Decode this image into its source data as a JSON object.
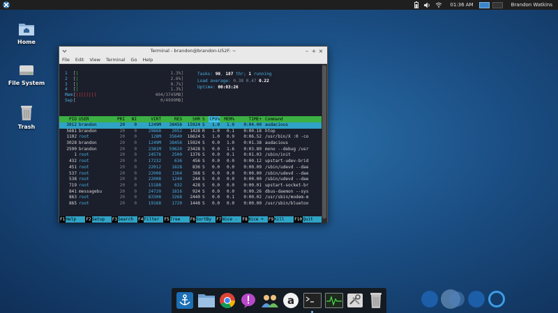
{
  "top_panel": {
    "clock": "01:36 AM",
    "user": "Brandon Watkins"
  },
  "desktop": {
    "icons": [
      {
        "label": "Home"
      },
      {
        "label": "File System"
      },
      {
        "label": "Trash"
      }
    ]
  },
  "terminal": {
    "title": "Terminal - brandon@brandon-U52F: ~",
    "menu": [
      "File",
      "Edit",
      "View",
      "Terminal",
      "Go",
      "Help"
    ],
    "meters": [
      {
        "label": "1",
        "bar": "|",
        "value": "1.3%]"
      },
      {
        "label": "2",
        "bar": "|",
        "value": "2.6%]"
      },
      {
        "label": "3",
        "bar": "|",
        "value": "0.7%]"
      },
      {
        "label": "4",
        "bar": "|",
        "value": "1.3%]"
      },
      {
        "label": "Mem",
        "bar": "||||||||",
        "value": "404/3745MB]"
      },
      {
        "label": "Swp",
        "bar": "",
        "value": "0/4999MB]"
      }
    ],
    "info": {
      "tasks_label": "Tasks:",
      "tasks": "90",
      "threads": "187",
      "thr_label": "thr;",
      "running": "1",
      "running_label": "running",
      "load_label": "Load average:",
      "load1": "0.38",
      "load5": "0.47",
      "load15": "0.22",
      "uptime_label": "Uptime:",
      "uptime": "00:03:26"
    },
    "columns": [
      "PID",
      "USER",
      "PRI",
      "NI",
      "VIRT",
      "RES",
      "SHR",
      "S",
      "CPU%",
      "MEM%",
      "TIME+",
      "Command"
    ],
    "processes": [
      {
        "pid": "3912",
        "user": "brandon",
        "pri": "20",
        "ni": "0",
        "virt": "1249M",
        "res": "38456",
        "shr": "15924",
        "s": "S",
        "cpu": "1.0",
        "mem": "1.0",
        "time": "0:04.00",
        "cmd": "audacious"
      },
      {
        "pid": "5681",
        "user": "brandon",
        "pri": "20",
        "ni": "0",
        "virt": "29868",
        "res": "2052",
        "shr": "1428",
        "s": "R",
        "cpu": "1.0",
        "mem": "0.1",
        "time": "0:00.18",
        "cmd": "htop"
      },
      {
        "pid": "1102",
        "user": "root",
        "pri": "20",
        "ni": "0",
        "virt": "128M",
        "res": "35640",
        "shr": "16624",
        "s": "S",
        "cpu": "1.0",
        "mem": "0.9",
        "time": "0:06.52",
        "cmd": "/usr/bin/X :0 -co"
      },
      {
        "pid": "3028",
        "user": "brandon",
        "pri": "20",
        "ni": "0",
        "virt": "1249M",
        "res": "38456",
        "shr": "15924",
        "s": "S",
        "cpu": "0.0",
        "mem": "1.0",
        "time": "0:01.38",
        "cmd": "audacious"
      },
      {
        "pid": "2590",
        "user": "brandon",
        "pri": "20",
        "ni": "0",
        "virt": "2381M",
        "res": "59620",
        "shr": "23428",
        "s": "S",
        "cpu": "0.0",
        "mem": "1.6",
        "time": "0:03.80",
        "cmd": "mono --debug /usr"
      },
      {
        "pid": "1",
        "user": "root",
        "pri": "20",
        "ni": "0",
        "virt": "24576",
        "res": "2500",
        "shr": "1376",
        "s": "S",
        "cpu": "0.0",
        "mem": "0.1",
        "time": "0:01.03",
        "cmd": "/sbin/init"
      },
      {
        "pid": "432",
        "user": "root",
        "pri": "20",
        "ni": "0",
        "virt": "17232",
        "res": "636",
        "shr": "456",
        "s": "S",
        "cpu": "0.0",
        "mem": "0.0",
        "time": "0:00.12",
        "cmd": "upstart-udev-brid"
      },
      {
        "pid": "451",
        "user": "root",
        "pri": "20",
        "ni": "0",
        "virt": "22012",
        "res": "1828",
        "shr": "836",
        "s": "S",
        "cpu": "0.0",
        "mem": "0.0",
        "time": "0:00.09",
        "cmd": "/sbin/udevd --dae"
      },
      {
        "pid": "537",
        "user": "root",
        "pri": "20",
        "ni": "0",
        "virt": "22008",
        "res": "1364",
        "shr": "368",
        "s": "S",
        "cpu": "0.0",
        "mem": "0.0",
        "time": "0:00.00",
        "cmd": "/sbin/udevd --dae"
      },
      {
        "pid": "538",
        "user": "root",
        "pri": "20",
        "ni": "0",
        "virt": "22008",
        "res": "1240",
        "shr": "244",
        "s": "S",
        "cpu": "0.0",
        "mem": "0.0",
        "time": "0:00.00",
        "cmd": "/sbin/udevd --dae"
      },
      {
        "pid": "719",
        "user": "root",
        "pri": "20",
        "ni": "0",
        "virt": "15188",
        "res": "632",
        "shr": "428",
        "s": "S",
        "cpu": "0.0",
        "mem": "0.0",
        "time": "0:00.01",
        "cmd": "upstart-socket-br"
      },
      {
        "pid": "841",
        "user": "messagebu",
        "pri": "20",
        "ni": "0",
        "virt": "24720",
        "res": "1816",
        "shr": "924",
        "s": "S",
        "cpu": "0.0",
        "mem": "0.0",
        "time": "0:00.26",
        "cmd": "dbus-daemon --sys"
      },
      {
        "pid": "863",
        "user": "root",
        "pri": "20",
        "ni": "0",
        "virt": "83308",
        "res": "3268",
        "shr": "2440",
        "s": "S",
        "cpu": "0.0",
        "mem": "0.1",
        "time": "0:00.02",
        "cmd": "/usr/sbin/modem-m"
      },
      {
        "pid": "865",
        "user": "root",
        "pri": "20",
        "ni": "0",
        "virt": "19168",
        "res": "1720",
        "shr": "1448",
        "s": "S",
        "cpu": "0.0",
        "mem": "0.0",
        "time": "0:00.00",
        "cmd": "/usr/sbin/bluetoo"
      }
    ],
    "fkeys": [
      {
        "key": "F1",
        "label": "Help"
      },
      {
        "key": "F2",
        "label": "Setup"
      },
      {
        "key": "F3",
        "label": "Search"
      },
      {
        "key": "F4",
        "label": "Filter"
      },
      {
        "key": "F5",
        "label": "Tree"
      },
      {
        "key": "F6",
        "label": "SortBy"
      },
      {
        "key": "F7",
        "label": "Nice -"
      },
      {
        "key": "F8",
        "label": "Nice +"
      },
      {
        "key": "F9",
        "label": "Kill"
      },
      {
        "key": "F10",
        "label": "Quit"
      }
    ]
  },
  "dock": {
    "items": [
      "anchor-icon",
      "folder-icon",
      "chrome-icon",
      "empathy-icon",
      "people-icon",
      "amazon-icon",
      "terminal-icon",
      "system-monitor-icon",
      "settings-icon",
      "trash-icon"
    ]
  },
  "colors": {
    "header_green": "#3cb043",
    "selected_row": "#2fa3c6",
    "accent_blue": "#49b0e0"
  }
}
